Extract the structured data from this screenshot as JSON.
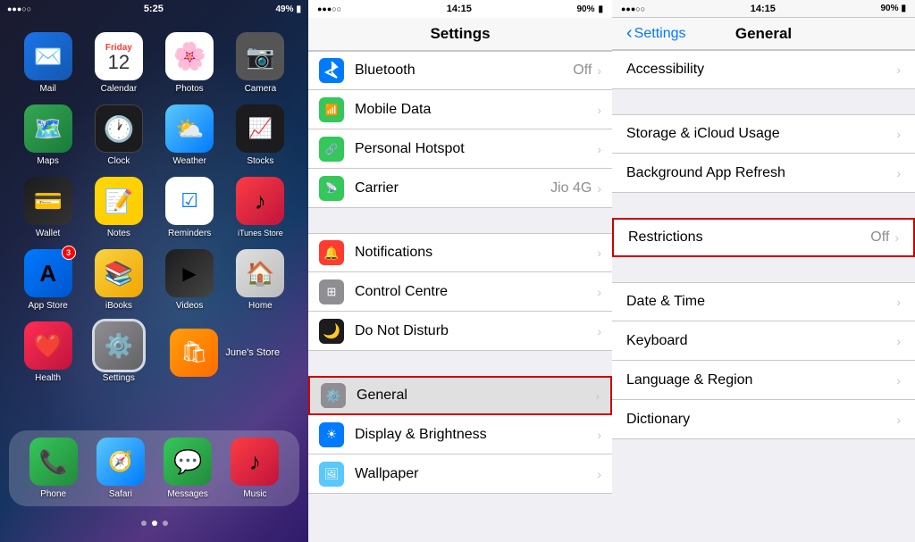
{
  "home": {
    "status": {
      "signal": "●●●○○",
      "time": "5:25",
      "battery": "49%"
    },
    "apps": [
      {
        "id": "mail",
        "label": "Mail",
        "icon": "✉️",
        "bg": "mail-bg",
        "badge": null
      },
      {
        "id": "calendar",
        "label": "Calendar",
        "icon": "calendar",
        "bg": "calendar-bg",
        "badge": null
      },
      {
        "id": "photos",
        "label": "Photos",
        "icon": "🌸",
        "bg": "photos-bg",
        "badge": null
      },
      {
        "id": "camera",
        "label": "Camera",
        "icon": "📷",
        "bg": "camera-bg",
        "badge": null
      },
      {
        "id": "maps",
        "label": "Maps",
        "icon": "🗺️",
        "bg": "maps-bg",
        "badge": null
      },
      {
        "id": "clock",
        "label": "Clock",
        "icon": "clock",
        "bg": "clock-bg",
        "badge": null
      },
      {
        "id": "weather",
        "label": "Weather",
        "icon": "⛅",
        "bg": "weather-bg",
        "badge": null
      },
      {
        "id": "stocks",
        "label": "Stocks",
        "icon": "📈",
        "bg": "stocks-bg",
        "badge": null
      },
      {
        "id": "wallet",
        "label": "Wallet",
        "icon": "💳",
        "bg": "wallet-bg",
        "badge": null
      },
      {
        "id": "notes",
        "label": "Notes",
        "icon": "📝",
        "bg": "notes-bg",
        "badge": null
      },
      {
        "id": "reminders",
        "label": "Reminders",
        "icon": "☑️",
        "bg": "reminders-bg",
        "badge": null
      },
      {
        "id": "itunes",
        "label": "iTunes Store",
        "icon": "🎵",
        "bg": "itunes-bg",
        "badge": null
      },
      {
        "id": "appstore",
        "label": "App Store",
        "icon": "A",
        "bg": "appstore-bg",
        "badge": "3"
      },
      {
        "id": "ibooks",
        "label": "iBooks",
        "icon": "📚",
        "bg": "ibooks-bg",
        "badge": null
      },
      {
        "id": "videos",
        "label": "Videos",
        "icon": "▶",
        "bg": "videos-bg",
        "badge": null
      },
      {
        "id": "home",
        "label": "Home",
        "icon": "🏠",
        "bg": "home-bg",
        "badge": null
      },
      {
        "id": "health",
        "label": "Health",
        "icon": "❤️",
        "bg": "health-bg",
        "badge": null
      },
      {
        "id": "settings",
        "label": "Settings",
        "icon": "⚙️",
        "bg": "settings-bg",
        "badge": null,
        "selected": true
      }
    ],
    "dock": [
      {
        "id": "phone",
        "label": "Phone",
        "icon": "📞",
        "bg": "phone-icon-bg"
      },
      {
        "id": "safari",
        "label": "Safari",
        "icon": "🧭",
        "bg": "safari-icon-bg"
      },
      {
        "id": "messages",
        "label": "Messages",
        "icon": "💬",
        "bg": "messages-icon-bg"
      },
      {
        "id": "music",
        "label": "Music",
        "icon": "🎵",
        "bg": "music-icon-bg"
      }
    ],
    "calendar_month": "Friday",
    "calendar_day": "12",
    "junes_store_label": "June's Store",
    "page_dots": [
      false,
      true,
      false
    ]
  },
  "settings": {
    "status": {
      "dots": "●●●○○",
      "time": "14:15",
      "battery": "90%"
    },
    "title": "Settings",
    "items": [
      {
        "id": "bluetooth",
        "label": "Bluetooth",
        "value": "Off",
        "icon_color": "blue-icon",
        "icon": "B",
        "section": 1
      },
      {
        "id": "mobile_data",
        "label": "Mobile Data",
        "value": "",
        "icon_color": "green-icon",
        "icon": "M",
        "section": 1
      },
      {
        "id": "personal_hotspot",
        "label": "Personal Hotspot",
        "value": "",
        "icon_color": "green-icon",
        "icon": "H",
        "section": 1
      },
      {
        "id": "carrier",
        "label": "Carrier",
        "value": "Jio 4G",
        "icon_color": "green-icon",
        "icon": "C",
        "section": 1
      },
      {
        "id": "notifications",
        "label": "Notifications",
        "value": "",
        "icon_color": "red-icon",
        "icon": "N",
        "section": 2
      },
      {
        "id": "control_centre",
        "label": "Control Centre",
        "value": "",
        "icon_color": "gray-icon",
        "icon": "CC",
        "section": 2
      },
      {
        "id": "do_not_disturb",
        "label": "Do Not Disturb",
        "value": "",
        "icon_color": "dark-icon",
        "icon": "🌙",
        "section": 2
      },
      {
        "id": "general",
        "label": "General",
        "value": "",
        "icon_color": "gray-icon",
        "icon": "⚙️",
        "section": 3,
        "highlighted": true
      },
      {
        "id": "display_brightness",
        "label": "Display & Brightness",
        "value": "",
        "icon_color": "blue-icon",
        "icon": "D",
        "section": 3
      },
      {
        "id": "wallpaper",
        "label": "Wallpaper",
        "value": "",
        "icon_color": "teal-icon",
        "icon": "W",
        "section": 3
      }
    ]
  },
  "general": {
    "status": {
      "dots": "●●●○○",
      "time": "14:15",
      "battery": "90%"
    },
    "back_label": "Settings",
    "title": "General",
    "items": [
      {
        "id": "accessibility",
        "label": "Accessibility",
        "value": "",
        "section": 1
      },
      {
        "id": "storage_icloud",
        "label": "Storage & iCloud Usage",
        "value": "",
        "section": 2
      },
      {
        "id": "background_refresh",
        "label": "Background App Refresh",
        "value": "",
        "section": 2
      },
      {
        "id": "restrictions",
        "label": "Restrictions",
        "value": "Off",
        "section": 3,
        "highlighted": true
      },
      {
        "id": "date_time",
        "label": "Date & Time",
        "value": "",
        "section": 4
      },
      {
        "id": "keyboard",
        "label": "Keyboard",
        "value": "",
        "section": 4
      },
      {
        "id": "language_region",
        "label": "Language & Region",
        "value": "",
        "section": 4
      },
      {
        "id": "dictionary",
        "label": "Dictionary",
        "value": "",
        "section": 4
      }
    ]
  }
}
